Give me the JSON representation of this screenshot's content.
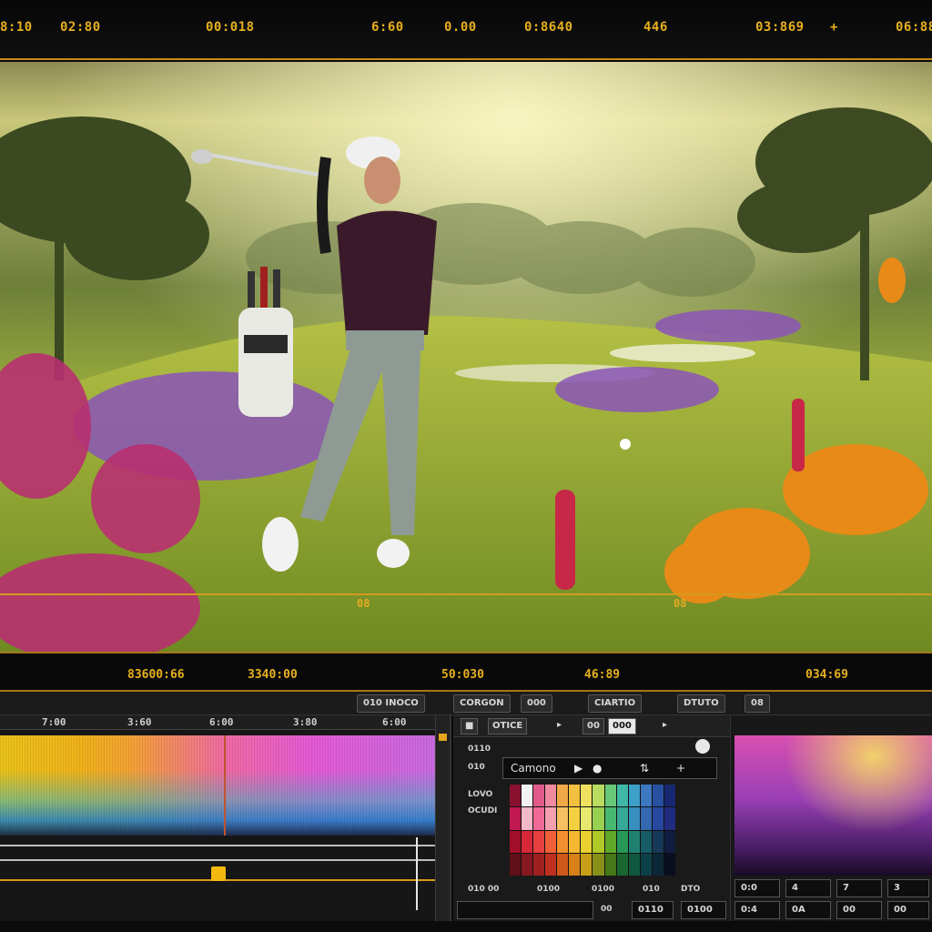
{
  "top_ruler": {
    "timecodes": [
      "8:10",
      "02:80",
      "00:018",
      "6:60",
      "0.00",
      "0:8640",
      "446",
      "03:869",
      "+",
      "06:88"
    ]
  },
  "viewer": {
    "scrub_timecodes": [
      "08",
      "08"
    ]
  },
  "mid_bar": {
    "timecodes": [
      "83600:66",
      "3340:00",
      "50:030",
      "46:89",
      "034:69"
    ]
  },
  "toolbar": {
    "buttons": [
      "010 INOCO",
      "CORGON",
      "000",
      "CIARTIO",
      "DTUTO",
      "08"
    ]
  },
  "timeline": {
    "ruler": [
      "7:00",
      "3:60",
      "6:00",
      "3:80",
      "6:00"
    ]
  },
  "color_panel": {
    "header_buttons": [
      "■",
      "OTICE",
      "▸",
      "00",
      "000",
      "▸"
    ],
    "labels": [
      "0110",
      "010",
      "LOVO",
      "OCUDI"
    ],
    "dropdown_value": "Camono",
    "dropdown_icons": [
      "play-icon",
      "record-icon",
      "arrows-icon",
      "add-icon"
    ],
    "footer": [
      "010 00",
      "0100",
      "0100",
      "010",
      "DTO"
    ],
    "footer2": [
      "00",
      "0110",
      "0100"
    ],
    "swatch_rows": [
      [
        "#8a1030",
        "#f2f2f2",
        "#e05a8a",
        "#f08aa0",
        "#f0a848",
        "#f2c040",
        "#f0e060",
        "#b8dc60",
        "#68c878",
        "#40b8a8",
        "#3ca0c8",
        "#3c78c0",
        "#2850a0",
        "#182870"
      ],
      [
        "#c01850",
        "#f4b8c8",
        "#f06a98",
        "#f4a0b0",
        "#f4c060",
        "#f4d040",
        "#e8e870",
        "#98d050",
        "#48b870",
        "#38a898",
        "#3890c0",
        "#3468b0",
        "#2848a0",
        "#202c80"
      ],
      [
        "#a01028",
        "#d82838",
        "#e84040",
        "#f06038",
        "#f49030",
        "#f4b830",
        "#e8d030",
        "#b0c828",
        "#60a828",
        "#289858",
        "#208070",
        "#185c68",
        "#183858",
        "#101c40"
      ],
      [
        "#601018",
        "#881820",
        "#a02020",
        "#c03020",
        "#d05818",
        "#d88018",
        "#c8a018",
        "#889018",
        "#487818",
        "#186830",
        "#105840",
        "#0c4048",
        "#0c2838",
        "#080e20"
      ]
    ]
  },
  "preview_panel": {
    "values_row1": [
      "0:0",
      "4",
      "7",
      "3"
    ],
    "values_row2": [
      "0:4",
      "0A",
      "00",
      "00"
    ]
  }
}
